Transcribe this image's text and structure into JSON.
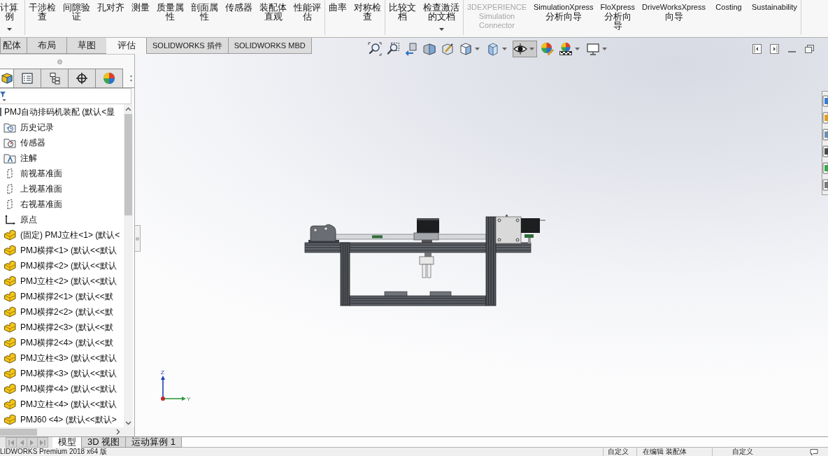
{
  "ribbon": {
    "groups": [
      {
        "buttons": [
          {
            "lines": [
              "计算",
              "例"
            ],
            "dropdown": true,
            "disabled": false
          }
        ]
      },
      {
        "buttons": [
          {
            "lines": [
              "干涉检",
              "查"
            ],
            "dropdown": false,
            "disabled": false
          },
          {
            "lines": [
              "间隙验",
              "证"
            ],
            "dropdown": false,
            "disabled": false
          },
          {
            "lines": [
              "孔对齐"
            ],
            "dropdown": false,
            "disabled": false
          },
          {
            "lines": [
              "测量"
            ],
            "dropdown": false,
            "disabled": false
          },
          {
            "lines": [
              "质量属",
              "性"
            ],
            "dropdown": false,
            "disabled": false
          },
          {
            "lines": [
              "剖面属",
              "性"
            ],
            "dropdown": false,
            "disabled": false
          },
          {
            "lines": [
              "传感器"
            ],
            "dropdown": false,
            "disabled": false
          },
          {
            "lines": [
              "装配体",
              "直观"
            ],
            "dropdown": false,
            "disabled": false
          },
          {
            "lines": [
              "性能评",
              "估"
            ],
            "dropdown": false,
            "disabled": false
          }
        ]
      },
      {
        "buttons": [
          {
            "lines": [
              "曲率"
            ],
            "dropdown": false,
            "disabled": false
          },
          {
            "lines": [
              "对称检",
              "查"
            ],
            "dropdown": false,
            "disabled": false
          }
        ]
      },
      {
        "buttons": [
          {
            "lines": [
              "比较文",
              "档"
            ],
            "dropdown": false,
            "disabled": false
          },
          {
            "lines": [
              "检查激活",
              "的文档"
            ],
            "dropdown": true,
            "disabled": false
          }
        ]
      },
      {
        "buttons": [
          {
            "lines": [
              "3DEXPERIENCE",
              "Simulation",
              "Connector"
            ],
            "dropdown": false,
            "disabled": true
          },
          {
            "lines": [
              "SimulationXpress",
              "分析向导"
            ],
            "dropdown": false,
            "disabled": false
          },
          {
            "lines": [
              "FloXpress",
              "分析向",
              "导"
            ],
            "dropdown": false,
            "disabled": false
          },
          {
            "lines": [
              "DriveWorksXpress",
              "向导"
            ],
            "dropdown": false,
            "disabled": false
          },
          {
            "lines": [
              "Costing"
            ],
            "dropdown": false,
            "disabled": false
          },
          {
            "lines": [
              "Sustainability"
            ],
            "dropdown": false,
            "disabled": false
          }
        ]
      }
    ]
  },
  "command_tabs": [
    {
      "label": "配体",
      "selected": false
    },
    {
      "label": "布局",
      "selected": false
    },
    {
      "label": "草图",
      "selected": false
    },
    {
      "label": "评估",
      "selected": true
    },
    {
      "label": "SOLIDWORKS 插件",
      "selected": false
    },
    {
      "label": "SOLIDWORKS MBD",
      "selected": false
    }
  ],
  "view_toolbar": [
    {
      "kind": "zoom-fit",
      "dropdown": false,
      "pressed": false
    },
    {
      "kind": "zoom-area",
      "dropdown": false,
      "pressed": false
    },
    {
      "kind": "previous-view",
      "dropdown": false,
      "pressed": false
    },
    {
      "kind": "section-view",
      "dropdown": false,
      "pressed": false
    },
    {
      "kind": "annotation-view",
      "dropdown": false,
      "pressed": false
    },
    {
      "kind": "view-orientation",
      "dropdown": true,
      "pressed": false
    },
    {
      "kind": "display-style",
      "dropdown": true,
      "pressed": false
    },
    {
      "kind": "hide-show",
      "dropdown": true,
      "pressed": true
    },
    {
      "kind": "edit-appearance",
      "dropdown": false,
      "pressed": false
    },
    {
      "kind": "apply-scene",
      "dropdown": true,
      "pressed": false
    },
    {
      "kind": "view-settings",
      "dropdown": true,
      "pressed": false
    }
  ],
  "panel_tabs": [
    {
      "kind": "feature-tree",
      "selected": true
    },
    {
      "kind": "property",
      "selected": false
    },
    {
      "kind": "configuration",
      "selected": false
    },
    {
      "kind": "dimxpert",
      "selected": false
    },
    {
      "kind": "display",
      "selected": false
    }
  ],
  "feature_tree": {
    "label": "PMJ自动排码机装配 (默认<显",
    "kind": "assembly",
    "children": [
      {
        "label": "历史记录",
        "kind": "history"
      },
      {
        "label": "传感器",
        "kind": "sensors"
      },
      {
        "label": "注解",
        "kind": "annotations"
      },
      {
        "label": "前视基准面",
        "kind": "plane"
      },
      {
        "label": "上视基准面",
        "kind": "plane"
      },
      {
        "label": "右视基准面",
        "kind": "plane"
      },
      {
        "label": "原点",
        "kind": "origin"
      },
      {
        "label": "(固定) PMJ立柱<1> (默认<",
        "kind": "part"
      },
      {
        "label": "PMJ横撑<1> (默认<<默认",
        "kind": "part"
      },
      {
        "label": "PMJ横撑<2> (默认<<默认",
        "kind": "part"
      },
      {
        "label": "PMJ立柱<2> (默认<<默认",
        "kind": "part"
      },
      {
        "label": "PMJ横撑2<1> (默认<<默",
        "kind": "part"
      },
      {
        "label": "PMJ横撑2<2> (默认<<默",
        "kind": "part"
      },
      {
        "label": "PMJ横撑2<3> (默认<<默",
        "kind": "part"
      },
      {
        "label": "PMJ横撑2<4> (默认<<默",
        "kind": "part"
      },
      {
        "label": "PMJ立柱<3> (默认<<默认",
        "kind": "part"
      },
      {
        "label": "PMJ横撑<3> (默认<<默认",
        "kind": "part"
      },
      {
        "label": "PMJ横撑<4> (默认<<默认",
        "kind": "part"
      },
      {
        "label": "PMJ立柱<4> (默认<<默认",
        "kind": "part"
      },
      {
        "label": "PMJ60 <4> (默认<<默认>",
        "kind": "part"
      }
    ]
  },
  "triad": {
    "z": "Z",
    "y": "Y"
  },
  "bottom_tabs": [
    {
      "label": "模型",
      "selected": true
    },
    {
      "label": "3D 视图",
      "selected": false
    },
    {
      "label": "运动算例 1",
      "selected": false
    }
  ],
  "status_bar": {
    "product": "LIDWORKS Premium 2018 x64 版",
    "fields": [
      "自定义",
      "在编辑 装配体",
      "自定义"
    ]
  }
}
